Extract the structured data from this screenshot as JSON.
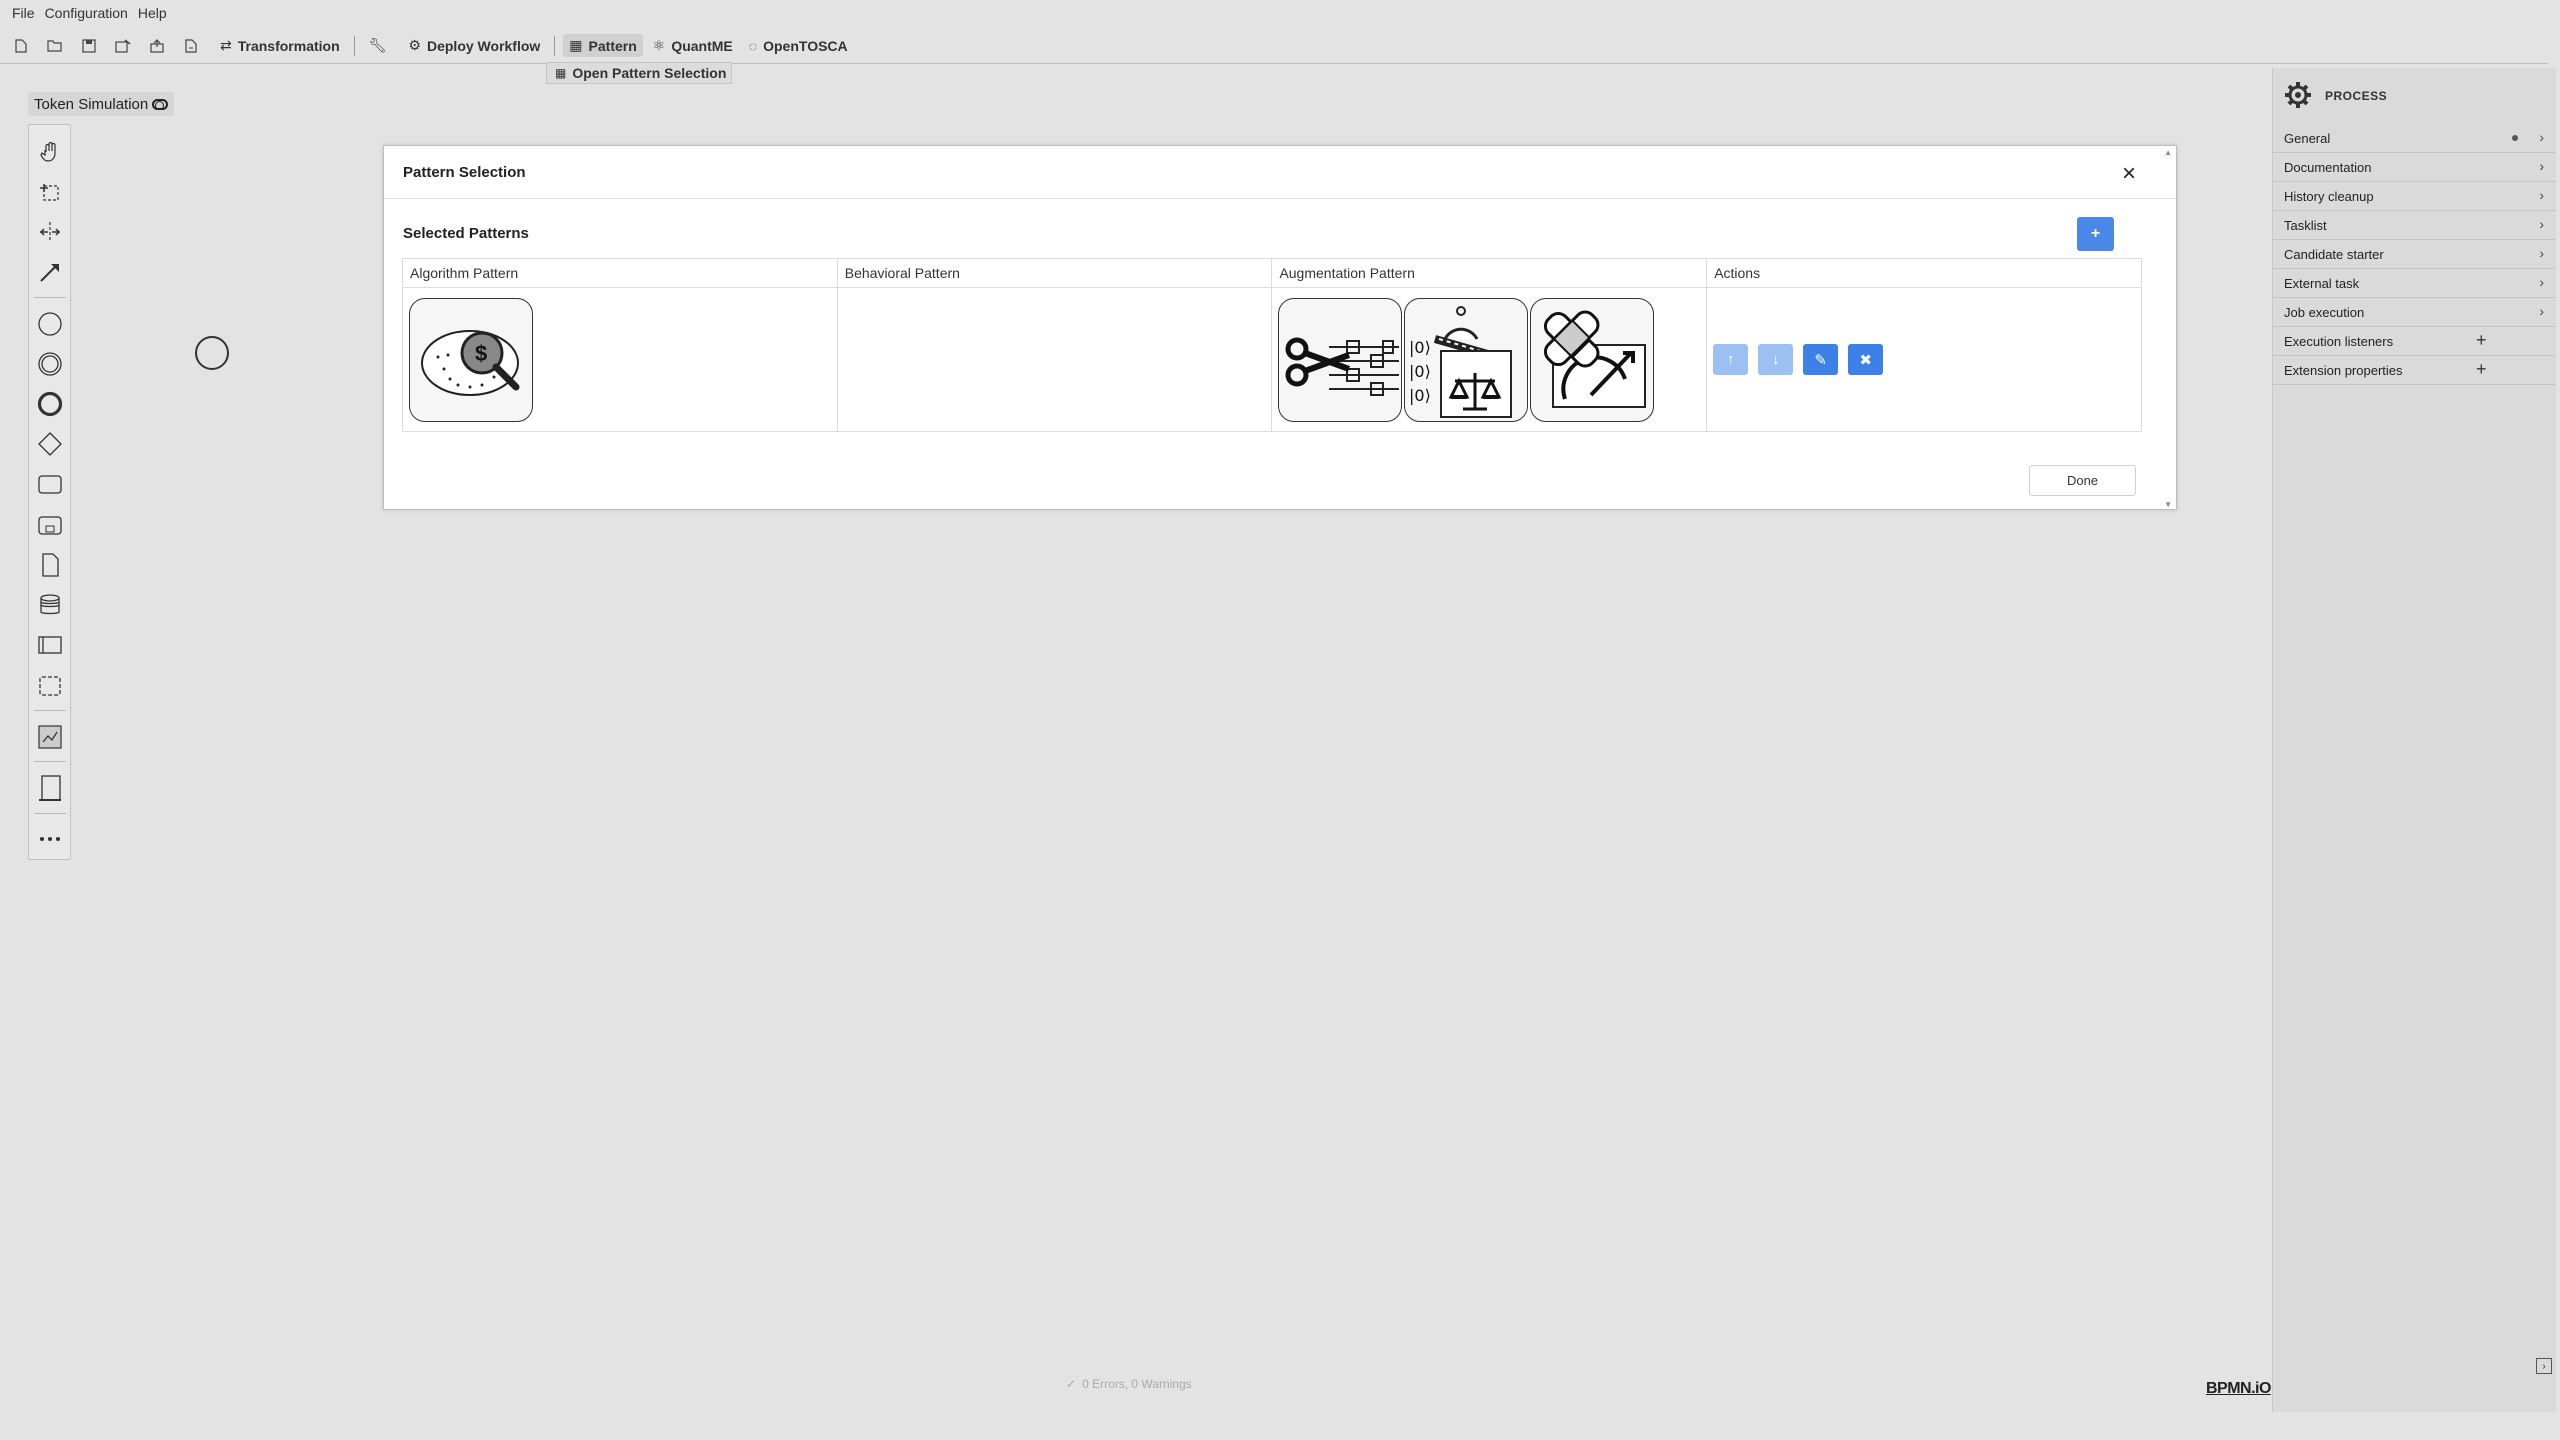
{
  "menu": [
    "File",
    "Configuration",
    "Help"
  ],
  "toolbar": {
    "icons": [
      "new-file-icon",
      "open-folder-icon",
      "save-icon",
      "save-as-icon",
      "upload-icon",
      "export-icon"
    ],
    "transformation_label": "Transformation",
    "deploy_label": "Deploy Workflow",
    "pattern_label": "Pattern",
    "quantme_label": "QuantME",
    "opentosca_label": "OpenTOSCA",
    "dropdown_item": "Open Pattern Selection"
  },
  "token_simulation": "Token Simulation",
  "palette": [
    "hand-tool-icon",
    "lasso-tool-icon",
    "space-tool-icon",
    "connect-tool-icon",
    "start-event-icon",
    "intermediate-event-icon",
    "end-event-icon",
    "gateway-icon",
    "task-icon",
    "subprocess-icon",
    "data-object-icon",
    "data-store-icon",
    "pool-icon",
    "group-icon",
    "pattern-icon",
    "lane-icon",
    "more-icon"
  ],
  "modal": {
    "title": "Pattern Selection",
    "section_title": "Selected Patterns",
    "add_label": "+",
    "done_label": "Done",
    "columns": [
      "Algorithm Pattern",
      "Behavioral Pattern",
      "Augmentation Pattern",
      "Actions"
    ],
    "row": {
      "algorithm": [
        "amplitude-amplification-pattern-icon"
      ],
      "behavioral": [],
      "augmentation": [
        "circuit-cutting-pattern-icon",
        "readout-error-mitigation-pattern-icon",
        "error-correction-pattern-icon"
      ],
      "actions": [
        {
          "name": "move-up-button",
          "label": "↑"
        },
        {
          "name": "move-down-button",
          "label": "↓"
        },
        {
          "name": "edit-button",
          "label": "✎"
        },
        {
          "name": "delete-button",
          "label": "✖"
        }
      ]
    }
  },
  "properties": {
    "header": "PROCESS",
    "items": [
      {
        "label": "General",
        "dot": true
      },
      {
        "label": "Documentation"
      },
      {
        "label": "History cleanup"
      },
      {
        "label": "Tasklist"
      },
      {
        "label": "Candidate starter"
      },
      {
        "label": "External task"
      },
      {
        "label": "Job execution"
      },
      {
        "label": "Execution listeners",
        "plus": true
      },
      {
        "label": "Extension properties",
        "plus": true
      }
    ]
  },
  "status": "0 Errors, 0 Warnings",
  "logo": "BPMN.iO"
}
